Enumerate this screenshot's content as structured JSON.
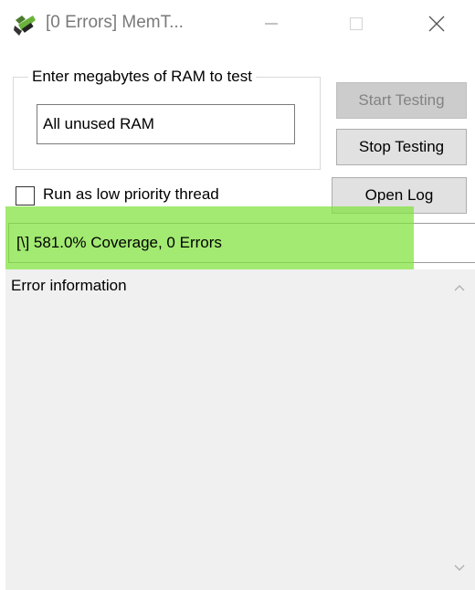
{
  "window": {
    "title": "[0 Errors] MemT...",
    "icon": "memtest-app-icon"
  },
  "ram_group": {
    "label": "Enter megabytes of RAM to test",
    "value": "All unused RAM"
  },
  "buttons": {
    "start": "Start Testing",
    "stop": "Stop Testing",
    "open_log": "Open Log"
  },
  "low_priority": {
    "label": "Run as low priority thread",
    "checked": false
  },
  "status": {
    "text": "[\\]  581.0% Coverage, 0 Errors",
    "highlight_color": "#7ee23a"
  },
  "error_pane": {
    "label": "Error information"
  },
  "colors": {
    "button_bg": "#e1e1e1",
    "button_disabled_bg": "#cccccc",
    "pane_bg": "#f0f0f0"
  }
}
